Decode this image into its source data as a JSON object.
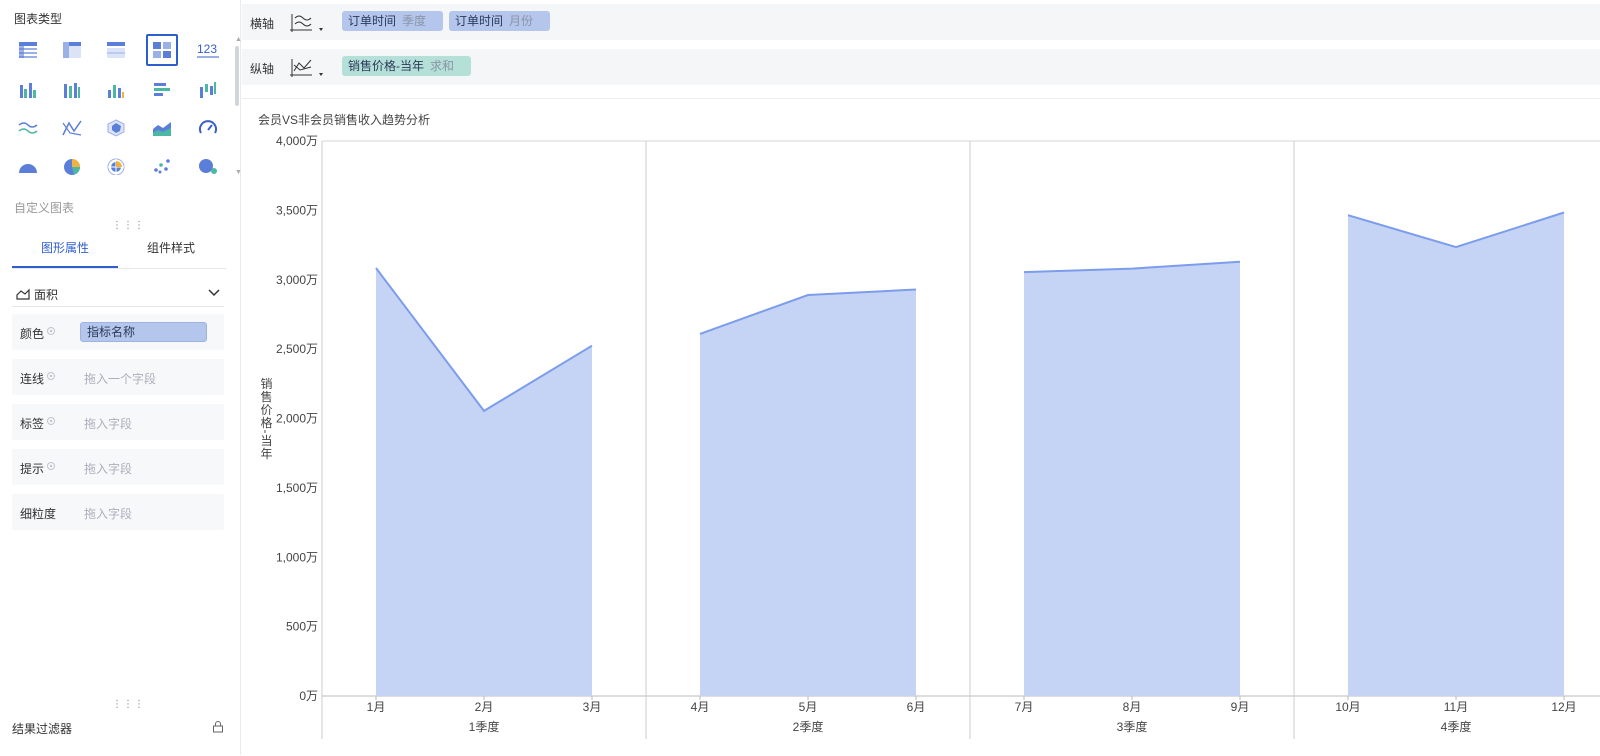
{
  "left_panel": {
    "chart_types_title": "图表类型",
    "custom_chart_label": "自定义图表",
    "tabs": [
      {
        "label": "图形属性",
        "active": true
      },
      {
        "label": "组件样式",
        "active": false
      }
    ],
    "mark_type": "面积",
    "properties": [
      {
        "label": "颜色",
        "value": "指标名称",
        "has_field": true
      },
      {
        "label": "连线",
        "value": "拖入一个字段",
        "has_field": false
      },
      {
        "label": "标签",
        "value": "拖入字段",
        "has_field": false
      },
      {
        "label": "提示",
        "value": "拖入字段",
        "has_field": false
      },
      {
        "label": "细粒度",
        "value": "拖入字段",
        "has_field": false
      }
    ],
    "filter_label": "结果过滤器",
    "number_icon_text": "123"
  },
  "shelves": {
    "x_label": "横轴",
    "y_label": "纵轴",
    "x_pills": [
      {
        "main": "订单时间",
        "agg": "季度"
      },
      {
        "main": "订单时间",
        "agg": "月份"
      }
    ],
    "y_pills": [
      {
        "main": "销售价格-当年",
        "agg": "求和"
      }
    ]
  },
  "colors": {
    "accent": "#2f5fcf",
    "area_fill": "#c5d4f5",
    "area_line": "#7c9cec"
  },
  "chart_data": {
    "type": "area",
    "title": "会员VS非会员销售收入趋势分析",
    "ylabel": "销售价格-当年",
    "ylim": [
      0,
      4000
    ],
    "y_ticks": [
      "0万",
      "500万",
      "1,000万",
      "1,500万",
      "2,000万",
      "2,500万",
      "3,000万",
      "3,500万",
      "4,000万"
    ],
    "y_tick_values": [
      0,
      500,
      1000,
      1500,
      2000,
      2500,
      3000,
      3500,
      4000
    ],
    "groups": [
      {
        "label": "1季度",
        "months": [
          "1月",
          "2月",
          "3月"
        ],
        "values": [
          3085,
          2055,
          2525
        ]
      },
      {
        "label": "2季度",
        "months": [
          "4月",
          "5月",
          "6月"
        ],
        "values": [
          2610,
          2890,
          2930
        ]
      },
      {
        "label": "3季度",
        "months": [
          "7月",
          "8月",
          "9月"
        ],
        "values": [
          3055,
          3080,
          3130
        ]
      },
      {
        "label": "4季度",
        "months": [
          "10月",
          "11月",
          "12月"
        ],
        "values": [
          3465,
          3235,
          3485
        ]
      }
    ]
  }
}
